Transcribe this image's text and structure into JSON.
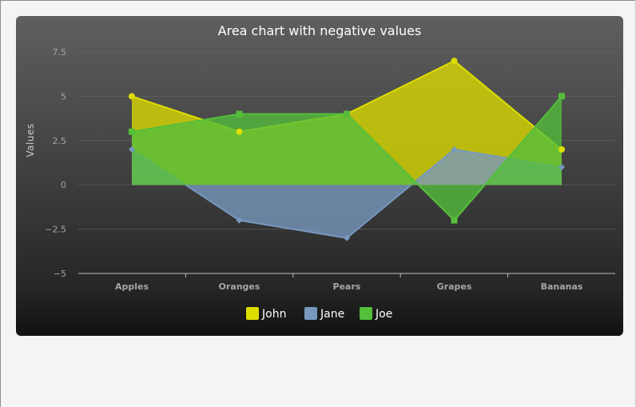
{
  "chart_data": {
    "type": "area",
    "title": "Area chart with negative values",
    "ylabel": "Values",
    "xlabel": "",
    "categories": [
      "Apples",
      "Oranges",
      "Pears",
      "Grapes",
      "Bananas"
    ],
    "ylim": [
      -5,
      7.5
    ],
    "y_ticks": [
      7.5,
      5,
      2.5,
      0,
      -2.5,
      -5
    ],
    "y_tick_labels": [
      "7.5",
      "5",
      "2.5",
      "0",
      "−2.5",
      "−5"
    ],
    "grid": true,
    "legend": "bottom-center",
    "series": [
      {
        "name": "John",
        "values": [
          5,
          3,
          4,
          7,
          2
        ],
        "color": "#dddd00",
        "marker": "circle"
      },
      {
        "name": "Jane",
        "values": [
          2,
          -2,
          -3,
          2,
          1
        ],
        "color": "#7798bf",
        "marker": "diamond"
      },
      {
        "name": "Joe",
        "values": [
          3,
          4,
          4,
          -2,
          5
        ],
        "color": "#55bf3b",
        "marker": "square"
      }
    ]
  }
}
